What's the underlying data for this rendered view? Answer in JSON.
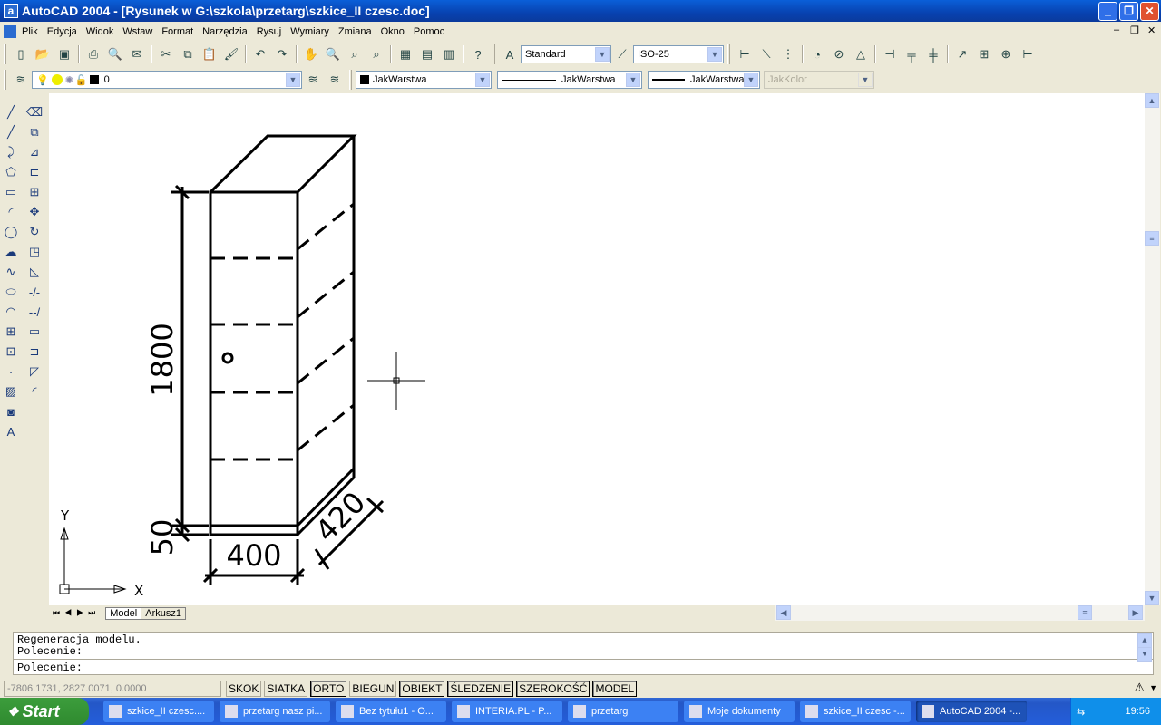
{
  "window": {
    "title": "AutoCAD 2004 - [Rysunek w G:\\szkola\\przetarg\\szkice_II czesc.doc]",
    "app_icon": "a"
  },
  "menu": [
    "Plik",
    "Edycja",
    "Widok",
    "Wstaw",
    "Format",
    "Narzędzia",
    "Rysuj",
    "Wymiary",
    "Zmiana",
    "Okno",
    "Pomoc"
  ],
  "toolbar1": {
    "text_style": "Standard",
    "dim_style": "ISO-25",
    "icons": [
      "new-icon",
      "open-icon",
      "save-icon",
      "print-icon",
      "preview-icon",
      "publish-icon",
      "cut-icon",
      "copy-icon",
      "paste-icon",
      "matchprop-icon",
      "undo-icon",
      "redo-icon",
      "pan-icon",
      "zoom-realtime-icon",
      "zoom-window-icon",
      "zoom-previous-icon",
      "properties-icon",
      "designcenter-icon",
      "toolpalettes-icon",
      "help-icon"
    ]
  },
  "layers": {
    "current_layer": "0",
    "color": "JakWarstwa",
    "linetype": "JakWarstwa",
    "lineweight": "JakWarstwa",
    "plotstyle": "JakKolor"
  },
  "left_toolbar": {
    "draw": [
      "line-icon",
      "xline-icon",
      "pline-icon",
      "polygon-icon",
      "rectangle-icon",
      "arc-icon",
      "circle-icon",
      "revcloud-icon",
      "spline-icon",
      "ellipse-icon",
      "ellipse-arc-icon",
      "insert-block-icon",
      "make-block-icon",
      "point-icon",
      "hatch-icon",
      "region-icon",
      "text-icon"
    ],
    "modify": [
      "erase-icon",
      "copy-object-icon",
      "mirror-icon",
      "offset-icon",
      "array-icon",
      "move-icon",
      "rotate-icon",
      "scale-icon",
      "stretch-icon",
      "trim-icon",
      "extend-icon",
      "break-icon",
      "chamfer-icon",
      "fillet-icon",
      "explode-icon"
    ]
  },
  "drawing": {
    "dim_height": "1800",
    "dim_plinth": "50",
    "dim_width": "400",
    "dim_depth": "420",
    "ucs_x": "X",
    "ucs_y": "Y"
  },
  "tabs": [
    "Model",
    "Arkusz1"
  ],
  "command": {
    "history": [
      "Regeneracja modelu.",
      "Polecenie:"
    ],
    "prompt": "Polecenie:"
  },
  "status": {
    "coords": "-7806.1731, 2827.0071, 0.0000",
    "buttons": [
      {
        "label": "SKOK",
        "on": false
      },
      {
        "label": "SIATKA",
        "on": false
      },
      {
        "label": "ORTO",
        "on": true
      },
      {
        "label": "BIEGUN",
        "on": false
      },
      {
        "label": "OBIEKT",
        "on": true
      },
      {
        "label": "ŚLEDZENIE",
        "on": true
      },
      {
        "label": "SZEROKOŚĆ",
        "on": true
      },
      {
        "label": "MODEL",
        "on": true
      }
    ]
  },
  "taskbar": {
    "start": "Start",
    "items": [
      "szkice_II czesc....",
      "przetarg nasz pi...",
      "Bez tytułu1 - O...",
      "INTERIA.PL - P...",
      "przetarg",
      "Moje dokumenty",
      "szkice_II czesc -...",
      "AutoCAD 2004 -..."
    ],
    "active": 7,
    "clock": "19:56"
  }
}
